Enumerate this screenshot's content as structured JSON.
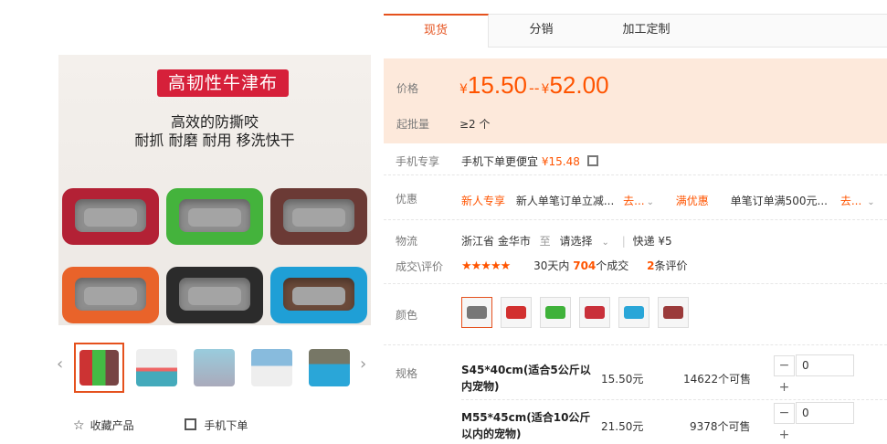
{
  "gallery": {
    "banner_tag": "高韧性牛津布",
    "slogan_line1": "高效的防撕咬",
    "slogan_line2": "耐抓 耐磨 耐用 移洗快干",
    "prev_arrow": "‹",
    "next_arrow": "›"
  },
  "actions": {
    "favorite_icon": "star-outline-icon",
    "favorite_glyph": "☆",
    "favorite_label": "收藏产品",
    "mobile_icon": "qr-code-icon",
    "mobile_label": "手机下单"
  },
  "tabs": [
    {
      "label": "现货",
      "active": true
    },
    {
      "label": "分销",
      "active": false
    },
    {
      "label": "加工定制",
      "active": false
    }
  ],
  "price": {
    "label": "价格",
    "currency": "¥",
    "min": "15.50",
    "separator": "--",
    "max": "52.00",
    "moq_label": "起批量",
    "moq_value": "≥2 个"
  },
  "mobile": {
    "label": "手机专享",
    "text": "手机下单更便宜",
    "price": "¥15.48"
  },
  "promo": {
    "label": "优惠",
    "tag1": "新人专享",
    "text1": "新人单笔订单立减...",
    "link1": "去...",
    "tag2": "满优惠",
    "text2": "单笔订单满500元...",
    "link2": "去..."
  },
  "logistics": {
    "label": "物流",
    "origin": "浙江省 金华市",
    "to": "至",
    "select": "请选择",
    "express": "快递 ¥5"
  },
  "reviews": {
    "label": "成交\\评价",
    "stars": "★★★★★",
    "days_text": "30天内",
    "deal_count": "704",
    "deal_suffix": "个成交",
    "review_count": "2",
    "review_suffix": "条评价"
  },
  "color": {
    "label": "颜色",
    "swatch_colors": [
      "#777777",
      "#d2302f",
      "#3fb23a",
      "#c9303a",
      "#2aa6d8",
      "#9b3b3b"
    ]
  },
  "specs": {
    "label": "规格",
    "items": [
      {
        "name": "S45*40cm(适合5公斤以内宠物)",
        "price": "15.50元",
        "stock": "14622个可售",
        "qty": "0"
      },
      {
        "name": "M55*45cm(适合10公斤以内的宠物)",
        "price": "21.50元",
        "stock": "9378个可售",
        "qty": "0"
      }
    ],
    "minus": "−",
    "plus": "+"
  },
  "colors": {
    "accent": "#ff5400",
    "price_bg": "#fde9db",
    "tag_red": "#d6203a"
  }
}
